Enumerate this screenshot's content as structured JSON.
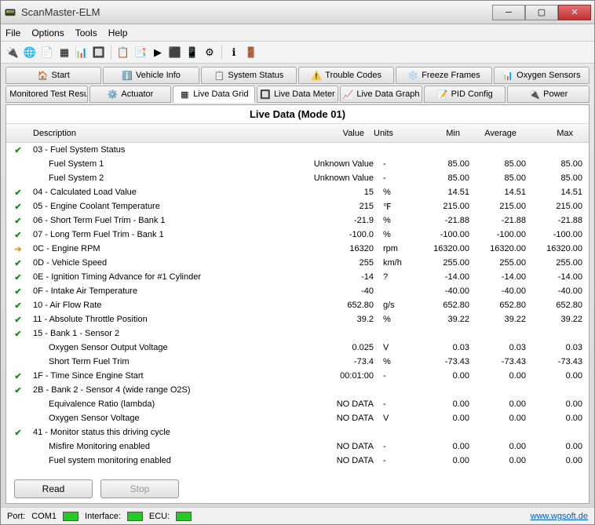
{
  "window": {
    "title": "ScanMaster-ELM"
  },
  "menu": {
    "file": "File",
    "options": "Options",
    "tools": "Tools",
    "help": "Help"
  },
  "tabs_row1": [
    {
      "label": "Start",
      "icon": "🏠"
    },
    {
      "label": "Vehicle Info",
      "icon": "ℹ️"
    },
    {
      "label": "System Status",
      "icon": "📋"
    },
    {
      "label": "Trouble Codes",
      "icon": "⚠️"
    },
    {
      "label": "Freeze Frames",
      "icon": "❄️"
    },
    {
      "label": "Oxygen Sensors",
      "icon": "📊"
    }
  ],
  "tabs_row2": [
    {
      "label": "Monitored Test Results",
      "icon": "🔘"
    },
    {
      "label": "Actuator",
      "icon": "⚙️"
    },
    {
      "label": "Live Data Grid",
      "icon": "▦",
      "active": true
    },
    {
      "label": "Live Data Meter",
      "icon": "🔲"
    },
    {
      "label": "Live Data Graph",
      "icon": "📈"
    },
    {
      "label": "PID Config",
      "icon": "📝"
    },
    {
      "label": "Power",
      "icon": "🔌"
    }
  ],
  "grid": {
    "title": "Live Data (Mode 01)",
    "headers": {
      "desc": "Description",
      "val": "Value",
      "units": "Units",
      "min": "Min",
      "avg": "Average",
      "max": "Max"
    },
    "rows": [
      {
        "icon": "check",
        "desc": "03 - Fuel System Status",
        "val": "",
        "units": "",
        "min": "",
        "avg": "",
        "max": ""
      },
      {
        "icon": "",
        "indent": true,
        "desc": "Fuel System 1",
        "val": "Unknown Value",
        "units": "-",
        "min": "85.00",
        "avg": "85.00",
        "max": "85.00"
      },
      {
        "icon": "",
        "indent": true,
        "desc": "Fuel System 2",
        "val": "Unknown Value",
        "units": "-",
        "min": "85.00",
        "avg": "85.00",
        "max": "85.00"
      },
      {
        "icon": "check",
        "desc": "04 - Calculated Load Value",
        "val": "15",
        "units": "%",
        "min": "14.51",
        "avg": "14.51",
        "max": "14.51"
      },
      {
        "icon": "check",
        "desc": "05 - Engine Coolant Temperature",
        "val": "215",
        "units": "℉",
        "min": "215.00",
        "avg": "215.00",
        "max": "215.00"
      },
      {
        "icon": "check",
        "desc": "06 - Short Term Fuel Trim - Bank 1",
        "val": "-21.9",
        "units": "%",
        "min": "-21.88",
        "avg": "-21.88",
        "max": "-21.88"
      },
      {
        "icon": "check",
        "desc": "07 - Long Term Fuel Trim - Bank 1",
        "val": "-100.0",
        "units": "%",
        "min": "-100.00",
        "avg": "-100.00",
        "max": "-100.00"
      },
      {
        "icon": "arrow",
        "desc": "0C - Engine RPM",
        "val": "16320",
        "units": "rpm",
        "min": "16320.00",
        "avg": "16320.00",
        "max": "16320.00"
      },
      {
        "icon": "check",
        "desc": "0D - Vehicle Speed",
        "val": "255",
        "units": "km/h",
        "min": "255.00",
        "avg": "255.00",
        "max": "255.00"
      },
      {
        "icon": "check",
        "desc": "0E - Ignition Timing Advance for #1 Cylinder",
        "val": "-14",
        "units": "?",
        "min": "-14.00",
        "avg": "-14.00",
        "max": "-14.00"
      },
      {
        "icon": "check",
        "desc": "0F - Intake Air Temperature",
        "val": "-40",
        "units": "",
        "min": "-40.00",
        "avg": "-40.00",
        "max": "-40.00"
      },
      {
        "icon": "check",
        "desc": "10 - Air Flow Rate",
        "val": "652.80",
        "units": "g/s",
        "min": "652.80",
        "avg": "652.80",
        "max": "652.80"
      },
      {
        "icon": "check",
        "desc": "11 - Absolute Throttle Position",
        "val": "39.2",
        "units": "%",
        "min": "39.22",
        "avg": "39.22",
        "max": "39.22"
      },
      {
        "icon": "check",
        "desc": "15 - Bank 1 - Sensor 2",
        "val": "",
        "units": "",
        "min": "",
        "avg": "",
        "max": ""
      },
      {
        "icon": "",
        "indent": true,
        "desc": "Oxygen Sensor Output Voltage",
        "val": "0.025",
        "units": "V",
        "min": "0.03",
        "avg": "0.03",
        "max": "0.03"
      },
      {
        "icon": "",
        "indent": true,
        "desc": "Short Term Fuel Trim",
        "val": "-73.4",
        "units": "%",
        "min": "-73.43",
        "avg": "-73.43",
        "max": "-73.43"
      },
      {
        "icon": "check",
        "desc": "1F - Time Since Engine Start",
        "val": "00:01:00",
        "units": "-",
        "min": "0.00",
        "avg": "0.00",
        "max": "0.00"
      },
      {
        "icon": "check",
        "desc": "2B - Bank 2 - Sensor 4 (wide range O2S)",
        "val": "",
        "units": "",
        "min": "",
        "avg": "",
        "max": ""
      },
      {
        "icon": "",
        "indent": true,
        "desc": "Equivalence Ratio (lambda)",
        "val": "NO DATA",
        "units": "-",
        "min": "0.00",
        "avg": "0.00",
        "max": "0.00"
      },
      {
        "icon": "",
        "indent": true,
        "desc": "Oxygen Sensor Voltage",
        "val": "NO DATA",
        "units": "V",
        "min": "0.00",
        "avg": "0.00",
        "max": "0.00"
      },
      {
        "icon": "check",
        "desc": "41 - Monitor status this driving cycle",
        "val": "",
        "units": "",
        "min": "",
        "avg": "",
        "max": ""
      },
      {
        "icon": "",
        "indent": true,
        "desc": "Misfire Monitoring enabled",
        "val": "NO DATA",
        "units": "-",
        "min": "0.00",
        "avg": "0.00",
        "max": "0.00"
      },
      {
        "icon": "",
        "indent": true,
        "desc": "Fuel system monitoring enabled",
        "val": "NO DATA",
        "units": "-",
        "min": "0.00",
        "avg": "0.00",
        "max": "0.00"
      }
    ]
  },
  "buttons": {
    "read": "Read",
    "stop": "Stop"
  },
  "status": {
    "port": "Port:",
    "port_val": "COM1",
    "iface": "Interface:",
    "ecu": "ECU:",
    "link": "www.wgsoft.de"
  }
}
